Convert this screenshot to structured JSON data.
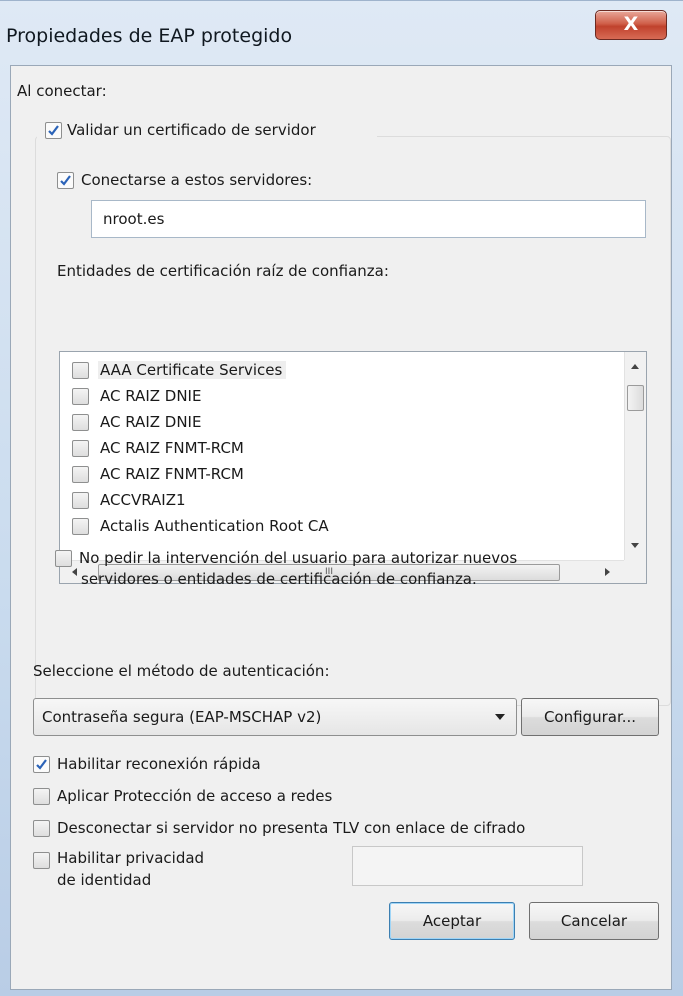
{
  "window": {
    "title": "Propiedades de EAP protegido",
    "close_glyph": "X"
  },
  "connect": {
    "heading": "Al conectar:",
    "validate_cert_label": "Validar un certificado de servidor",
    "validate_cert_checked": true,
    "connect_servers_label": "Conectarse a estos servidores:",
    "connect_servers_checked": true,
    "servers_value": "nroot.es",
    "trusted_root_label": "Entidades de certificación raíz de confianza:",
    "trusted_roots": [
      {
        "label": "AAA Certificate Services",
        "checked": false
      },
      {
        "label": "AC RAIZ DNIE",
        "checked": false
      },
      {
        "label": "AC RAIZ DNIE",
        "checked": false
      },
      {
        "label": "AC RAIZ FNMT-RCM",
        "checked": false
      },
      {
        "label": "AC RAIZ FNMT-RCM",
        "checked": false
      },
      {
        "label": "ACCVRAIZ1",
        "checked": false
      },
      {
        "label": "Actalis Authentication Root CA",
        "checked": false
      }
    ],
    "hscroll_grip": "III",
    "no_prompt_label_line1": "No pedir la intervención del usuario para autorizar nuevos",
    "no_prompt_label_line2": "servidores o entidades de certificación de confianza.",
    "no_prompt_checked": false
  },
  "auth": {
    "method_label": "Seleccione el método de autenticación:",
    "method_value": "Contraseña segura (EAP-MSCHAP v2)",
    "configure_button": "Configurar...",
    "options": {
      "fast_reconnect": {
        "label": "Habilitar reconexión rápida",
        "checked": true
      },
      "nap": {
        "label": "Aplicar Protección de acceso a redes",
        "checked": false
      },
      "tlv": {
        "label": "Desconectar si servidor no presenta TLV con enlace de cifrado",
        "checked": false
      },
      "privacy_line1": "Habilitar privacidad",
      "privacy_line2": "de identidad",
      "privacy_checked": false
    }
  },
  "buttons": {
    "ok": "Aceptar",
    "cancel": "Cancelar"
  },
  "colors": {
    "accent_check": "#2b63b8",
    "close_button": "#c9503b"
  }
}
